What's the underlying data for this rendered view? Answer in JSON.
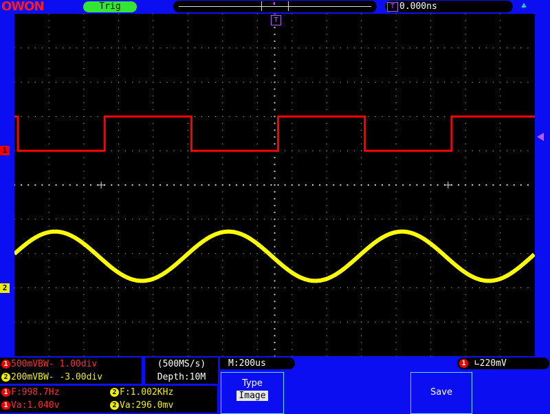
{
  "header": {
    "logo": "OWON",
    "trig_status": "Trig",
    "trigger_position": "0.000ns",
    "trigger_position_badge": "T"
  },
  "screen": {
    "ch1_marker": "1",
    "ch2_marker": "2",
    "trigger_marker": "T",
    "ch1_color": "#ff0000",
    "ch2_color": "#ffff00"
  },
  "channels": {
    "ch1": {
      "badge": "1",
      "text": "500mVBW- 1.00div"
    },
    "ch2": {
      "badge": "2",
      "text": "200mVBW- -3.00div"
    }
  },
  "acquisition": {
    "sample_rate": "(500MS/s)",
    "depth": "Depth:10M",
    "timebase": "M:200us"
  },
  "trigger": {
    "badge": "1",
    "level": "220mV"
  },
  "measurements": {
    "ch1_freq": "F:998.7Hz",
    "ch1_va": "Va:1.040v",
    "ch2_freq": "F:1.002KHz",
    "ch2_va": "Va:296.0mv"
  },
  "menu": {
    "type_label": "Type",
    "type_value": "Image",
    "save_label": "Save"
  }
}
